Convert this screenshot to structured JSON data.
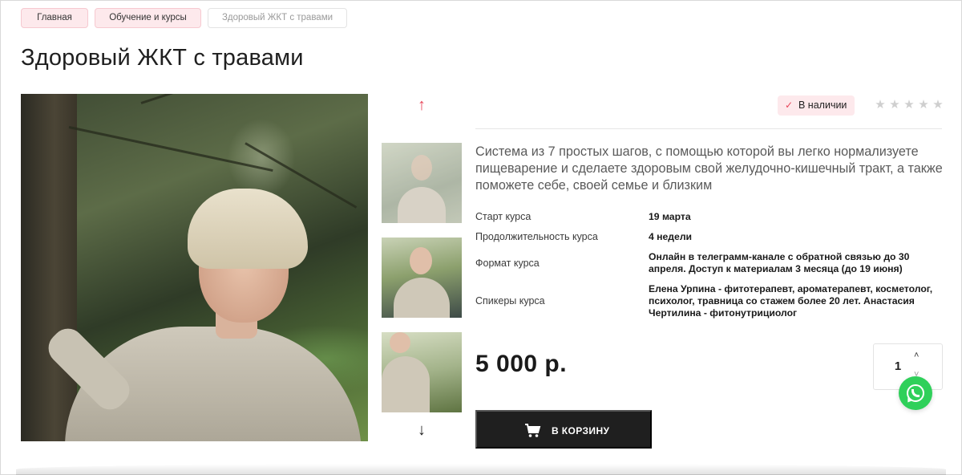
{
  "breadcrumbs": [
    {
      "label": "Главная"
    },
    {
      "label": "Обучение и курсы"
    },
    {
      "label": "Здоровый ЖКТ с травами"
    }
  ],
  "product": {
    "title": "Здоровый ЖКТ с травами",
    "stock_label": "В наличии",
    "rating": {
      "value": 0,
      "max": 5
    },
    "description": "Система из 7 простых шагов, с помощью которой вы легко нормализуете пищеварение и сделаете здоровым свой желудочно-кишечный тракт, а также поможете себе, своей семье и близким",
    "properties": [
      {
        "label": "Старт курса",
        "value": "19 марта"
      },
      {
        "label": "Продолжительность курса",
        "value": "4 недели"
      },
      {
        "label": "Формат курса",
        "value": "Онлайн в телеграмм-канале с обратной связью до 30 апреля. Доступ к материалам 3 месяца (до 19 июня)"
      },
      {
        "label": "Спикеры курса",
        "value": "Елена Урпина - фитотерапевт, ароматерапевт, косметолог, психолог, травница со стажем более 20 лет. Анастасия Чертилина - фитонутрициолог"
      }
    ],
    "price": "5 000 р.",
    "quantity": "1",
    "cart_button_label": "В КОРЗИНУ"
  },
  "icons": {
    "thumb_up": "arrow-up-icon",
    "thumb_down": "arrow-down-icon",
    "stock": "check-icon",
    "star": "star-icon",
    "cart": "cart-icon",
    "chat": "whatsapp-icon"
  },
  "colors": {
    "accent": "#e8465a",
    "accent_bg": "#fde9ec",
    "button_bg": "#1f1f1f",
    "whatsapp": "#2fd05a"
  }
}
